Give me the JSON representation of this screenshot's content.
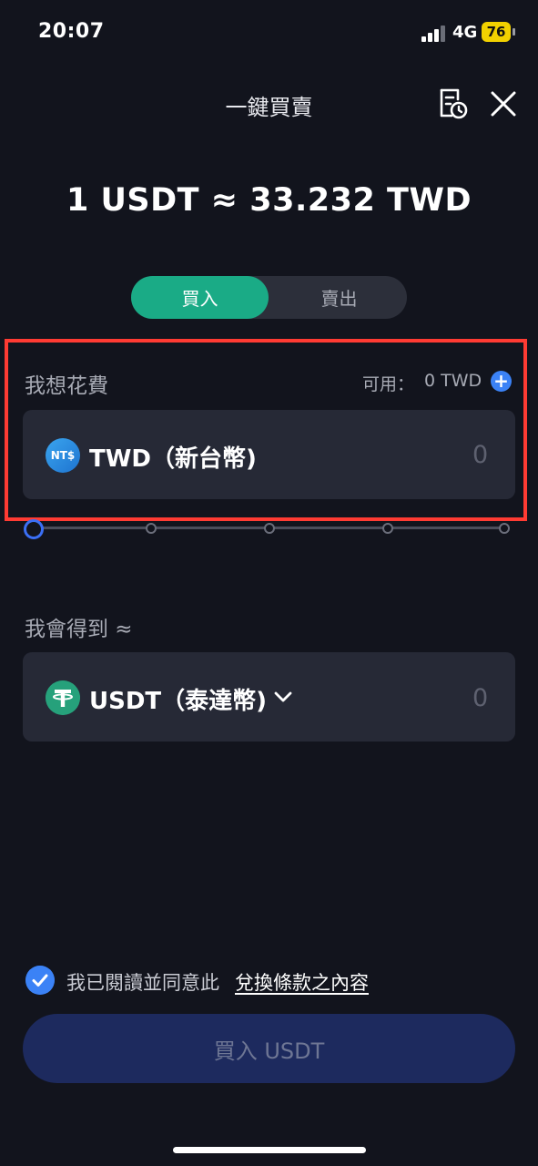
{
  "status_bar": {
    "time": "20:07",
    "network": "4G",
    "battery": "76"
  },
  "header": {
    "title": "一鍵買賣"
  },
  "rate": {
    "text": "1 USDT ≈ 33.232 TWD"
  },
  "tabs": [
    {
      "label": "買入",
      "active": true
    },
    {
      "label": "賣出",
      "active": false
    }
  ],
  "spend": {
    "label": "我想花費",
    "available_label": "可用：",
    "available_value": "0 TWD",
    "currency_icon_text": "NT$",
    "currency_name": "TWD（新台幣)",
    "amount": "0"
  },
  "slider": {
    "value_percent": 0
  },
  "receive": {
    "label": "我會得到 ≈",
    "currency_name": "USDT（泰達幣)",
    "amount": "0"
  },
  "agreement": {
    "checked": true,
    "text": "我已閱讀並同意此",
    "link": "兌換條款之內容"
  },
  "submit": {
    "label": "買入 USDT"
  },
  "colors": {
    "accent_green": "#1aab86",
    "accent_blue": "#3b82f6",
    "highlight_red": "#ff3b33",
    "background": "#12141d"
  }
}
